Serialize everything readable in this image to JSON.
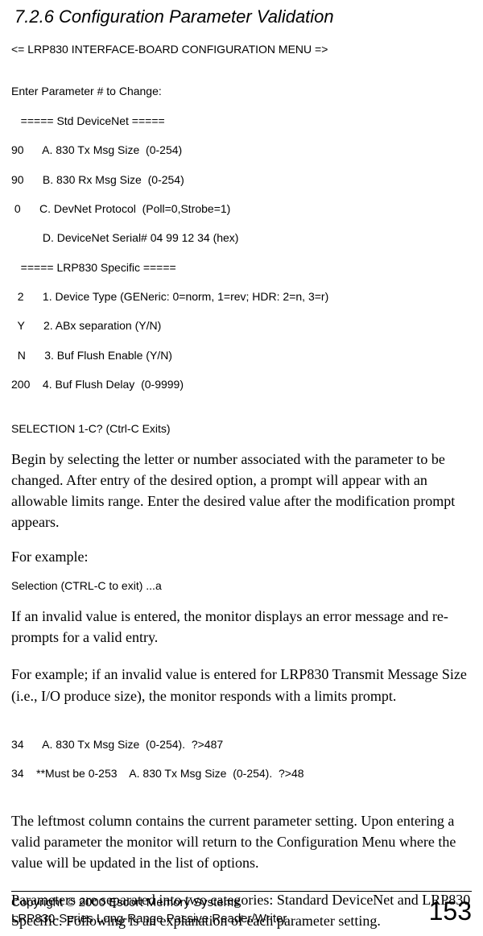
{
  "heading": "7.2.6  Configuration Parameter Validation",
  "menu_header": "<= LRP830 INTERFACE-BOARD CONFIGURATION MENU =>",
  "param_prompt": "Enter Parameter # to Change:",
  "std_divider": "   ===== Std DeviceNet =====",
  "rows": {
    "a": "90      A. 830 Tx Msg Size  (0-254)",
    "b": "90      B. 830 Rx Msg Size  (0-254)",
    "c": " 0      C. DevNet Protocol  (Poll=0,Strobe=1)",
    "d": "          D. DeviceNet Serial# 04 99 12 34 (hex)"
  },
  "lrp_divider": "   ===== LRP830 Specific =====",
  "lrp_rows": {
    "r1": "  2      1. Device Type (GENeric: 0=norm, 1=rev; HDR: 2=n, 3=r)",
    "r2": "  Y      2. ABx separation (Y/N)",
    "r3": "  N      3. Buf Flush Enable (Y/N)",
    "r4": "200    4. Buf Flush Delay  (0-9999)"
  },
  "selection_line": "SELECTION 1-C? (Ctrl-C Exits)",
  "para1": "Begin by selecting the letter or number associated with the parameter to be changed.  After entry of the desired option, a prompt will appear with an allowable limits range.  Enter the desired value after the modification prompt appears.",
  "for_example": "For example:",
  "selection_example": "Selection (CTRL-C to exit) ...a",
  "para2": "If an invalid value is entered, the monitor displays an error message and re-prompts for a valid entry.",
  "para3": "For example; if an invalid value is entered for LRP830 Transmit Message Size (i.e., I/O produce size), the monitor responds with a limits prompt.",
  "invalid_example": {
    "l1": "34      A. 830 Tx Msg Size  (0-254).  ?>487",
    "l2": "34    **Must be 0-253    A. 830 Tx Msg Size  (0-254).  ?>48"
  },
  "para4": "The leftmost column contains the current parameter setting.  Upon entering a valid parameter the monitor will return to the Configuration Menu where the value will be updated in the list of options.",
  "para5": "Parameters are separated into two categories: Standard DeviceNet and LRP830 Specific.  Following is an explanation of each parameter setting.",
  "footer": {
    "line1": "Copyright © 2000 Escort Memory Systems",
    "line2": "LRP830-Series Long-Range Passive Reader/Writer",
    "page": "153"
  }
}
